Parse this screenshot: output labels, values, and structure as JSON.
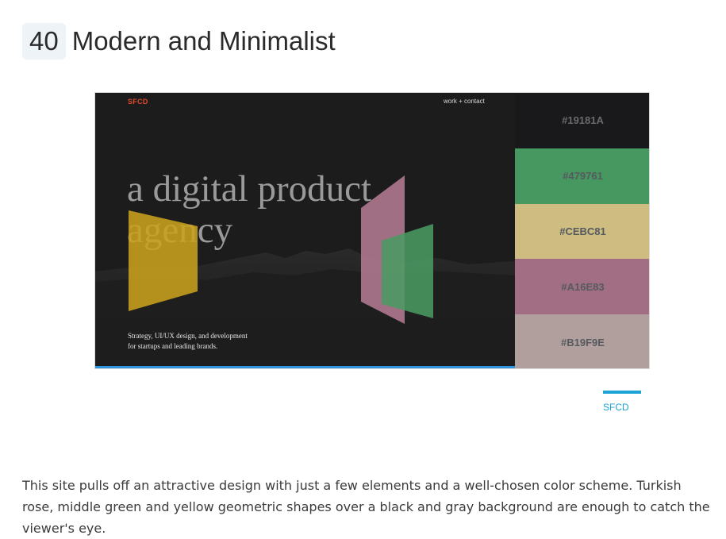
{
  "heading": {
    "number": "40",
    "title": "Modern and Minimalist"
  },
  "screenshot": {
    "site": {
      "logo": "SFCD",
      "nav": "work + contact",
      "headline_line1": "a digital product",
      "headline_line2": "agency",
      "tagline_line1": "Strategy, UI/UX design, and development",
      "tagline_line2": "for startups and leading brands."
    },
    "palette": [
      {
        "hex": "#19181A",
        "color": "#19181a"
      },
      {
        "hex": "#479761",
        "color": "#479761"
      },
      {
        "hex": "#CEBC81",
        "color": "#cebc81"
      },
      {
        "hex": "#A16E83",
        "color": "#a16e83"
      },
      {
        "hex": "#B19F9E",
        "color": "#b19f9e"
      }
    ],
    "accent_colors": {
      "yellow": "#c9a21c",
      "rose": "#b37b92",
      "green": "#4a9a62",
      "progress": "#2f94e0",
      "logo": "#e14a2c"
    }
  },
  "source": {
    "label": "SFCD"
  },
  "description": "This site pulls off an attractive design with just a few elements and a well-chosen color scheme. Turkish rose, middle green and yellow geometric shapes over a black and gray background are enough to catch the viewer's eye."
}
